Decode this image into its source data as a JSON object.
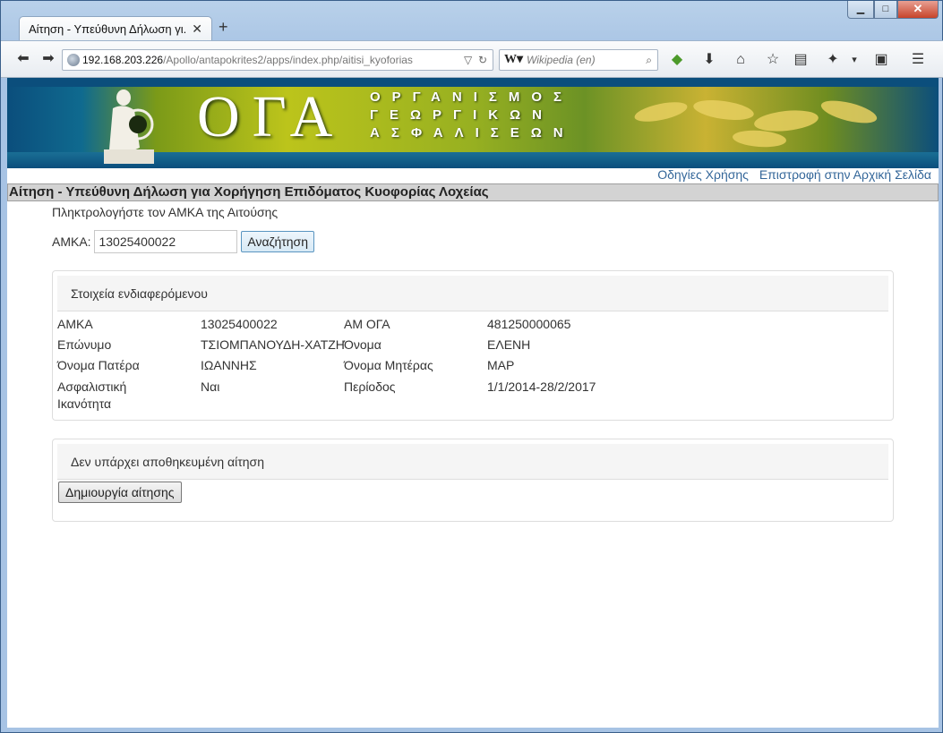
{
  "browser": {
    "tab_title": "Αίτηση - Υπεύθυνη Δήλωση γι...",
    "url_host": "192.168.203.226",
    "url_path": "/Apollo/antapokrites2/apps/index.php/aitisi_kyoforias",
    "search_placeholder": "Wikipedia (en)"
  },
  "banner": {
    "logo": "ΟΓΑ",
    "org_line1": "ΟΡΓΑΝΙΣΜΟΣ",
    "org_line2": "ΓΕΩΡΓΙΚΩΝ",
    "org_line3": "ΑΣΦΑΛΙΣΕΩΝ"
  },
  "links": {
    "help": "Οδηγίες Χρήσης",
    "home": "Επιστροφή στην Αρχική Σελίδα"
  },
  "page": {
    "title": "Αίτηση - Υπεύθυνη Δήλωση για Χορήγηση Επιδόματος Κυοφορίας Λοχείας",
    "prompt": "Πληκτρολογήστε τον ΑΜΚΑ της Αιτούσης",
    "amka_label": "ΑΜΚΑ:",
    "amka_value": "13025400022",
    "search_button": "Αναζήτηση"
  },
  "details": {
    "heading": "Στοιχεία ενδιαφερόμενου",
    "amka_label": "ΑΜΚΑ",
    "amka_value": "13025400022",
    "am_oga_label": "ΑΜ ΟΓΑ",
    "am_oga_value": "481250000065",
    "surname_label": "Επώνυμο",
    "surname_value": "ΤΣΙΟΜΠΑΝΟΥΔΗ-ΧΑΤΖΗ",
    "name_label": "Όνομα",
    "name_value": "ΕΛΕΝΗ",
    "father_label": "Όνομα Πατέρα",
    "father_value": "ΙΩΑΝΝΗΣ",
    "mother_label": "Όνομα Μητέρας",
    "mother_value": "ΜΑΡ",
    "insurance_label": "Ασφαλιστική Ικανότητα",
    "insurance_value": "Ναι",
    "period_label": "Περίοδος",
    "period_value": "1/1/2014-28/2/2017"
  },
  "application": {
    "heading": "Δεν υπάρχει αποθηκευμένη αίτηση",
    "create_button": "Δημιουργία αίτησης"
  }
}
